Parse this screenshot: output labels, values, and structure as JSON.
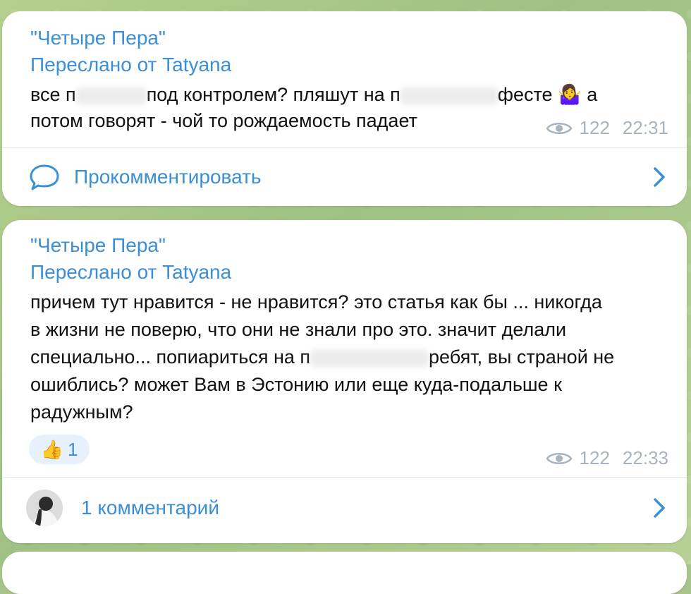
{
  "messages": [
    {
      "channel": "\"Четыре Пера\"",
      "forwarded": "Переслано от Tatyana",
      "line1_a": "все п",
      "line1_b": "под контролем? пляшут на п",
      "line1_c": "фесте",
      "line1_d": "а",
      "line2": "потом говорят - чой то рождаемость падает",
      "views": "122",
      "time": "22:31",
      "comment_label": "Прокомментировать"
    },
    {
      "channel": "\"Четыре Пера\"",
      "forwarded": "Переслано от Tatyana",
      "line1": "причем тут нравится - не нравится? это статья как бы ... никогда",
      "line2": "в жизни не поверю, что они не знали про это. значит делали",
      "line3_a": "специально... попиариться на п",
      "line3_b": "ребят, вы страной не",
      "line4": "ошиблись? может Вам в Эстонию или еще куда-подальше к",
      "line5": "радужным?",
      "reaction_emoji": "👍",
      "reaction_count": "1",
      "views": "122",
      "time": "22:33",
      "comment_label": "1 комментарий"
    }
  ],
  "emoji_shrug": "🤷‍♀️",
  "icons": {
    "comment": "speech-bubble-icon",
    "views": "eye-icon",
    "chevron": "chevron-right-icon"
  },
  "colors": {
    "accent": "#3a8fd6",
    "meta": "#a9b3bd",
    "background": "#a7c58a"
  }
}
